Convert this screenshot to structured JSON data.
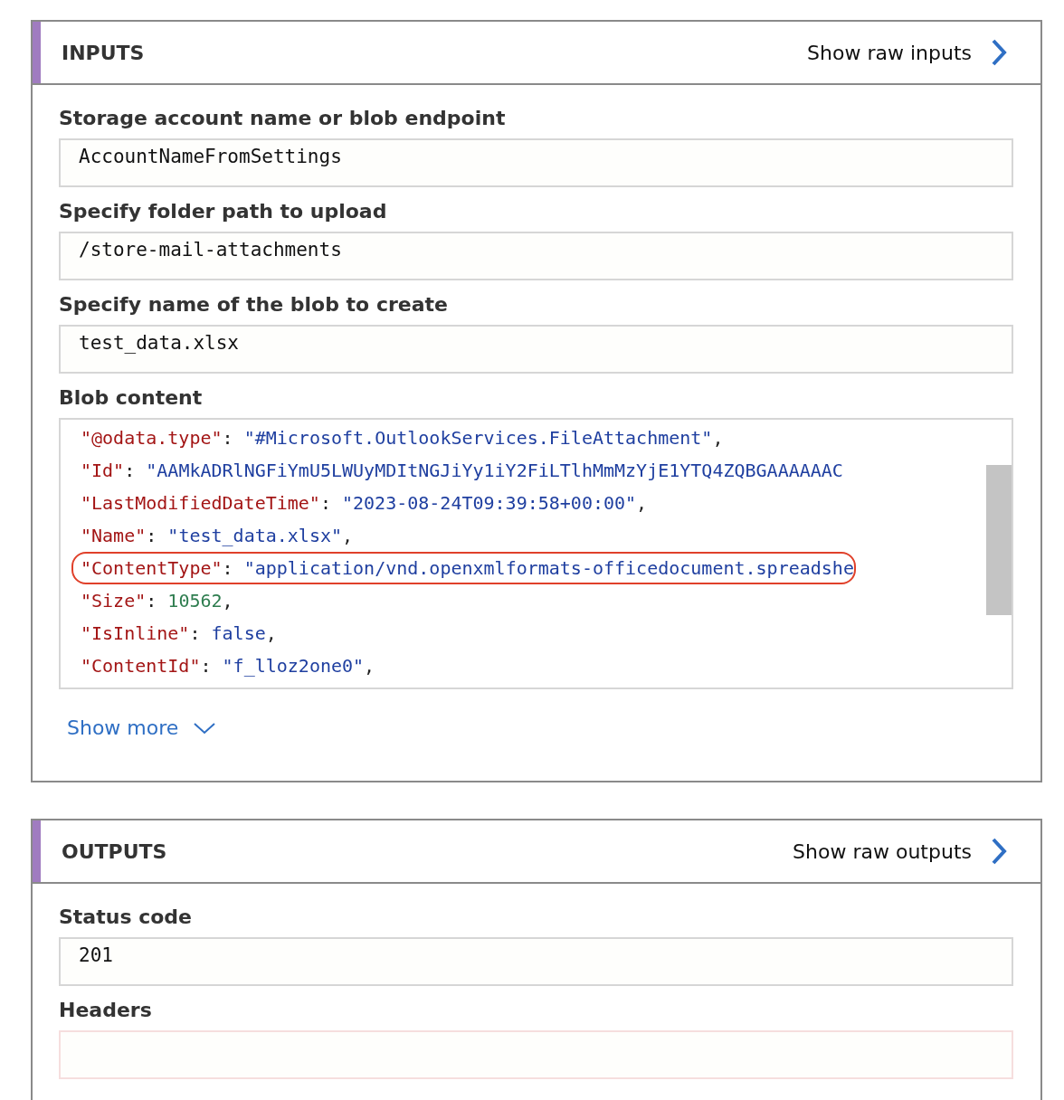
{
  "sections": [
    {
      "title": "INPUTS",
      "raw_link": "Show raw inputs",
      "fields": [
        {
          "kind": "text",
          "label": "Storage account name or blob endpoint",
          "value": "AccountNameFromSettings"
        },
        {
          "kind": "text",
          "label": "Specify folder path to upload",
          "value": "/store-mail-attachments"
        },
        {
          "kind": "text",
          "label": "Specify name of the blob to create",
          "value": "test_data.xlsx"
        },
        {
          "kind": "code",
          "label": "Blob content",
          "lines": [
            {
              "key": "\"@odata.type\"",
              "colon": ":",
              "value": "\"#Microsoft.OutlookServices.FileAttachment\"",
              "color": "#1f3fa0",
              "comma": ",",
              "highlighted": false
            },
            {
              "key": "\"Id\"",
              "colon": ":",
              "value": "\"AAMkADRlNGFiYmU5LWUyMDItNGJiYy1iY2FiLTlhMmMzYjE1YTQ4ZQBGAAAAAAC",
              "color": "#1f3fa0",
              "highlighted": false
            },
            {
              "key": "\"LastModifiedDateTime\"",
              "colon": ":",
              "value": "\"2023-08-24T09:39:58+00:00\"",
              "color": "#1f3fa0",
              "comma": ",",
              "highlighted": false
            },
            {
              "key": "\"Name\"",
              "colon": ":",
              "value": "\"test_data.xlsx\"",
              "color": "#1f3fa0",
              "comma": ",",
              "highlighted": false
            },
            {
              "key": "\"ContentType\"",
              "colon": ":",
              "value": "\"application/vnd.openxmlformats-officedocument.spreadshe",
              "color": "#1f3fa0",
              "highlighted": true
            },
            {
              "key": "\"Size\"",
              "colon": ":",
              "value": "10562",
              "color": "#2e7d4f",
              "comma": ",",
              "highlighted": false
            },
            {
              "key": "\"IsInline\"",
              "colon": ":",
              "value": "false",
              "color": "#1f3fa0",
              "comma": ",",
              "highlighted": false
            },
            {
              "key": "\"ContentId\"",
              "colon": ":",
              "value": "\"f_lloz2one0\"",
              "color": "#1f3fa0",
              "comma": ",",
              "highlighted": false
            }
          ]
        }
      ],
      "show_more": "Show more"
    },
    {
      "title": "OUTPUTS",
      "raw_link": "Show raw outputs",
      "fields": [
        {
          "kind": "text",
          "label": "Status code",
          "value": "201"
        },
        {
          "kind": "text",
          "label": "Headers"
        }
      ]
    }
  ]
}
